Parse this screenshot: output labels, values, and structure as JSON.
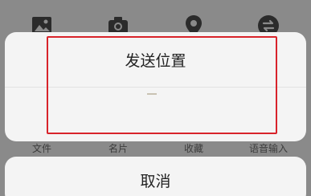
{
  "toolbar": {
    "items": [
      {
        "label": "文件",
        "icon": "image-icon"
      },
      {
        "label": "名片",
        "icon": "camera-icon"
      },
      {
        "label": "收藏",
        "icon": "location-pin-icon"
      },
      {
        "label": "语音输入",
        "icon": "swap-icon"
      }
    ]
  },
  "sheet": {
    "send_location_label": "发送位置",
    "cancel_label": "取消"
  },
  "colors": {
    "highlight": "#d8232a",
    "sheet_bg": "#f4f4f4",
    "backdrop": "#8a8a8a"
  }
}
